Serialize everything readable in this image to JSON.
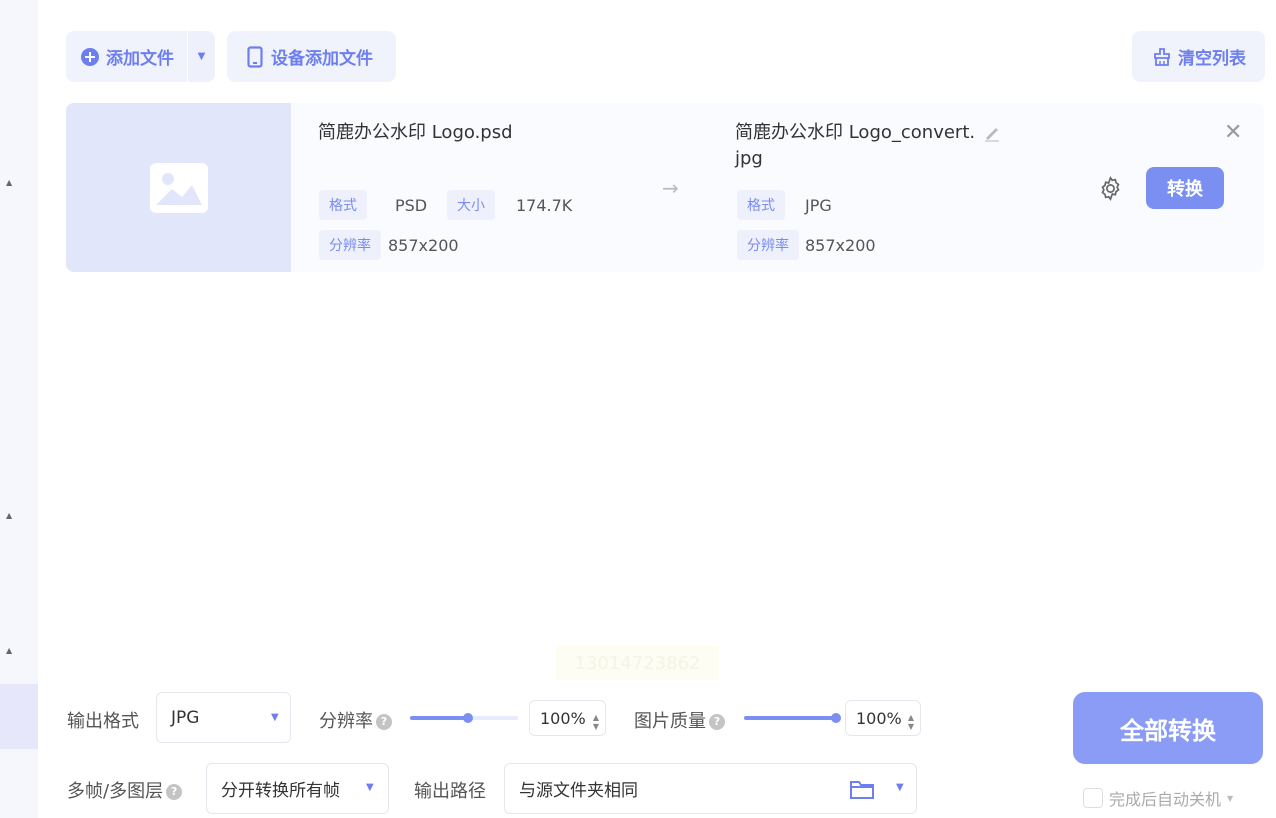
{
  "toolbar": {
    "add_file": "添加文件",
    "device_add_file": "设备添加文件",
    "clear_list": "清空列表"
  },
  "file": {
    "source_name": "简鹿办公水印 Logo.psd",
    "source_format_label": "格式",
    "source_format": "PSD",
    "source_size_label": "大小",
    "source_size": "174.7K",
    "source_res_label": "分辨率",
    "source_res": "857x200",
    "target_name_line1": "简鹿办公水印 Logo_convert.",
    "target_name_line2": "jpg",
    "target_format_label": "格式",
    "target_format": "JPG",
    "target_res_label": "分辨率",
    "target_res": "857x200",
    "convert_label": "转换"
  },
  "settings": {
    "output_format_label": "输出格式",
    "output_format_value": "JPG",
    "resolution_label": "分辨率",
    "resolution_value": "100%",
    "resolution_fraction": 0.54,
    "quality_label": "图片质量",
    "quality_value": "100%",
    "quality_fraction": 1.0,
    "multiframe_label": "多帧/多图层",
    "multiframe_value": "分开转换所有帧",
    "output_path_label": "输出路径",
    "output_path_value": "与源文件夹相同"
  },
  "actions": {
    "convert_all": "全部转换",
    "auto_shutdown": "完成后自动关机"
  },
  "watermark": {
    "text": "13014723862"
  },
  "colors": {
    "accent": "#7b8ff2",
    "accent_light": "#e2e6fa"
  }
}
